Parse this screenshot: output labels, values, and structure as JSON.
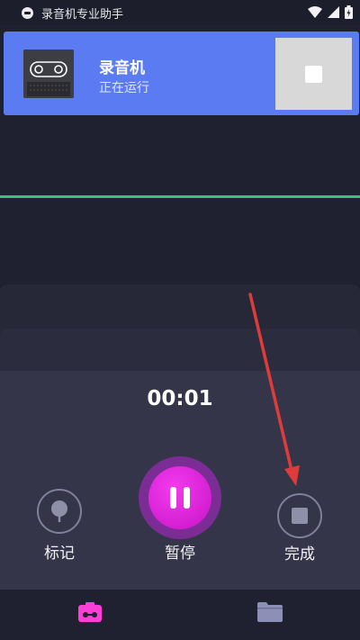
{
  "status_bar": {
    "title": "录音机专业助手",
    "icons": [
      "app-badge-icon",
      "wifi-icon",
      "signal-icon",
      "battery-icon"
    ]
  },
  "notification": {
    "title": "录音机",
    "subtitle": "正在运行",
    "thumb_icon": "cassette-icon",
    "stop_icon": "stop-icon",
    "bg_color": "#5b7bf2"
  },
  "waveform": {
    "line_color": "#33c477"
  },
  "recorder": {
    "timer": "00:01",
    "mark_label": "标记",
    "pause_label": "暂停",
    "done_label": "完成",
    "accent_color": "#e026e0"
  },
  "bottom_nav": {
    "items": [
      {
        "icon": "recorder-icon",
        "active": true
      },
      {
        "icon": "folder-icon",
        "active": false
      }
    ],
    "active_color": "#ff3dd7"
  },
  "annotation": {
    "arrow_color": "#e03b3b",
    "points_to": "完成"
  }
}
